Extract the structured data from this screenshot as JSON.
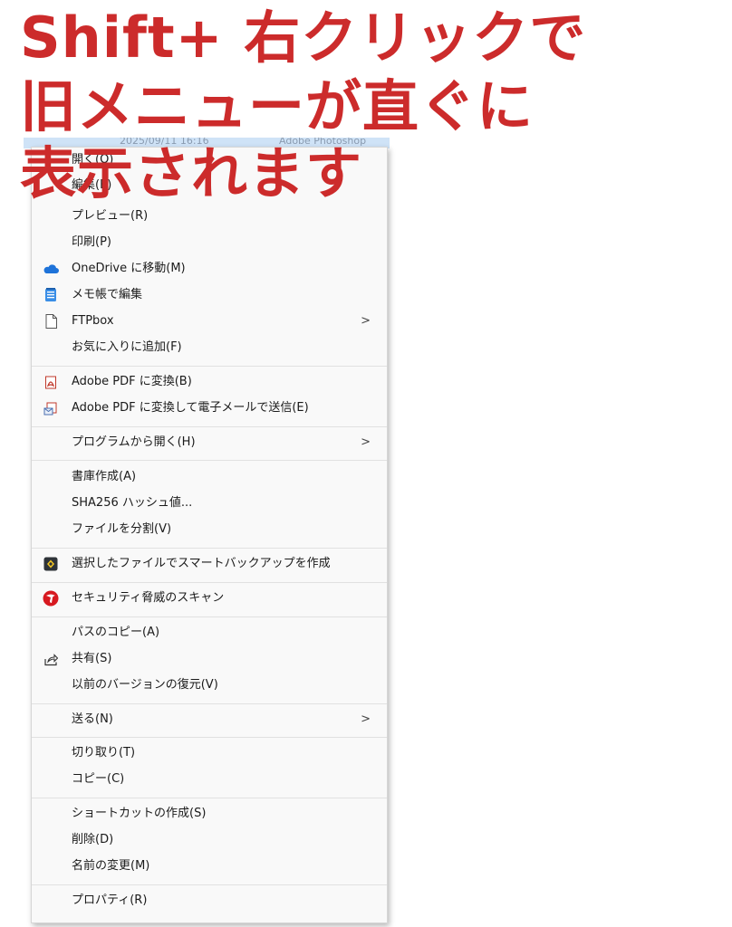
{
  "headline": {
    "line1": "Shift+ 右クリックで",
    "line2": "旧メニューが直ぐに",
    "line3": "表示されます",
    "color": "#cc2b2b"
  },
  "background_row": {
    "date": "2025/09/11 16:16",
    "app": "Adobe Photoshop"
  },
  "menu": {
    "items": [
      {
        "label": "開く(O)",
        "icon": "none"
      },
      {
        "label": "編集(E)",
        "icon": "none"
      },
      {
        "label": "プレビュー(R)",
        "icon": "none"
      },
      {
        "label": "印刷(P)",
        "icon": "none"
      },
      {
        "label": "OneDrive に移動(M)",
        "icon": "onedrive-cloud-icon"
      },
      {
        "label": "メモ帳で編集",
        "icon": "notepad-icon"
      },
      {
        "label": "FTPbox",
        "icon": "file-icon",
        "submenu": true
      },
      {
        "label": "お気に入りに追加(F)",
        "icon": "none"
      },
      {
        "label": "Adobe PDF に変換(B)",
        "icon": "adobe-pdf-icon"
      },
      {
        "label": "Adobe PDF に変換して電子メールで送信(E)",
        "icon": "adobe-pdf-mail-icon"
      },
      {
        "label": "プログラムから開く(H)",
        "icon": "none",
        "submenu": true
      },
      {
        "label": "書庫作成(A)",
        "icon": "none"
      },
      {
        "label": "SHA256 ハッシュ値...",
        "icon": "none"
      },
      {
        "label": "ファイルを分割(V)",
        "icon": "none"
      },
      {
        "label": "選択したファイルでスマートバックアップを作成",
        "icon": "smart-backup-icon"
      },
      {
        "label": "セキュリティ脅威のスキャン",
        "icon": "trend-micro-icon"
      },
      {
        "label": "パスのコピー(A)",
        "icon": "none"
      },
      {
        "label": "共有(S)",
        "icon": "share-icon"
      },
      {
        "label": "以前のバージョンの復元(V)",
        "icon": "none"
      },
      {
        "label": "送る(N)",
        "icon": "none",
        "submenu": true
      },
      {
        "label": "切り取り(T)",
        "icon": "none"
      },
      {
        "label": "コピー(C)",
        "icon": "none"
      },
      {
        "label": "ショートカットの作成(S)",
        "icon": "none"
      },
      {
        "label": "削除(D)",
        "icon": "none"
      },
      {
        "label": "名前の変更(M)",
        "icon": "none"
      },
      {
        "label": "プロパティ(R)",
        "icon": "none"
      }
    ],
    "submenu_arrow": ">"
  }
}
